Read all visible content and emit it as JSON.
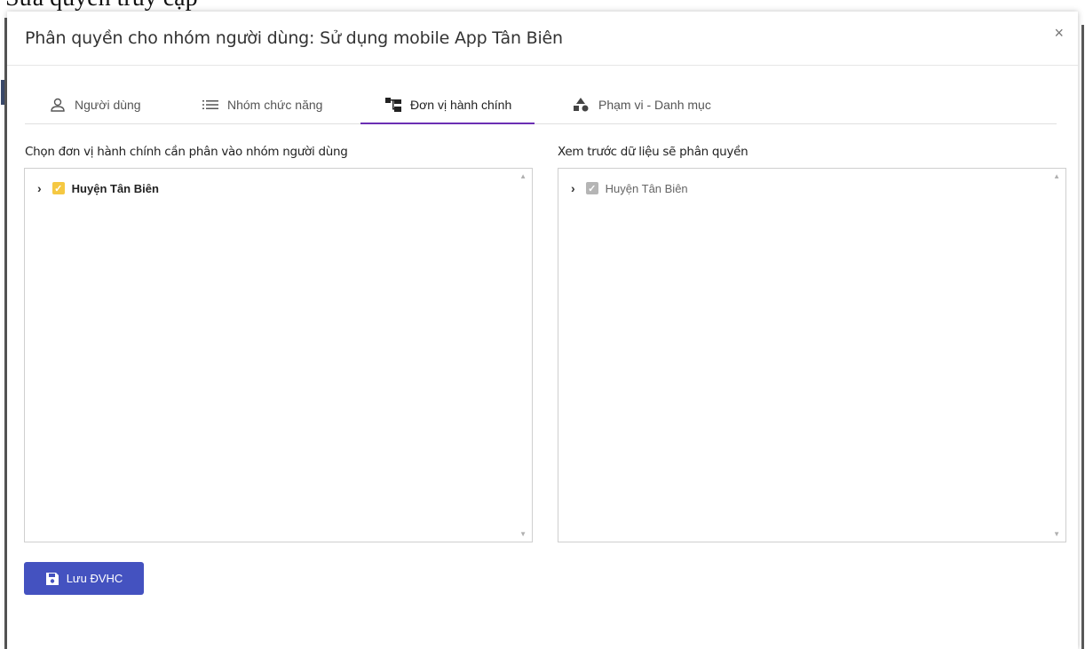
{
  "background": {
    "title_fragment": "Sửa quyền truy cập"
  },
  "modal": {
    "title": "Phân quyền cho nhóm người dùng: Sử dụng mobile App Tân Biên",
    "close_symbol": "×"
  },
  "tabs": [
    {
      "label": "Người dùng",
      "icon": "user-icon",
      "active": false
    },
    {
      "label": "Nhóm chức năng",
      "icon": "list-icon",
      "active": false
    },
    {
      "label": "Đơn vị hành chính",
      "icon": "org-chart-icon",
      "active": true
    },
    {
      "label": "Phạm vi - Danh mục",
      "icon": "shapes-icon",
      "active": false
    }
  ],
  "left_panel": {
    "label": "Chọn đơn vị hành chính cần phân vào nhóm người dùng",
    "tree": [
      {
        "label": "Huyện Tân Biên",
        "checked": true
      }
    ]
  },
  "right_panel": {
    "label": "Xem trước dữ liệu sẽ phân quyền",
    "tree": [
      {
        "label": "Huyện Tân Biên",
        "checked": true
      }
    ]
  },
  "save_button": {
    "label": "Lưu ĐVHC",
    "icon": "floppy-disk-icon"
  },
  "colors": {
    "accent_tab": "#6b2fb3",
    "checkbox_active": "#f5c842",
    "checkbox_disabled": "#b5b5b5",
    "button": "#4452c0"
  }
}
